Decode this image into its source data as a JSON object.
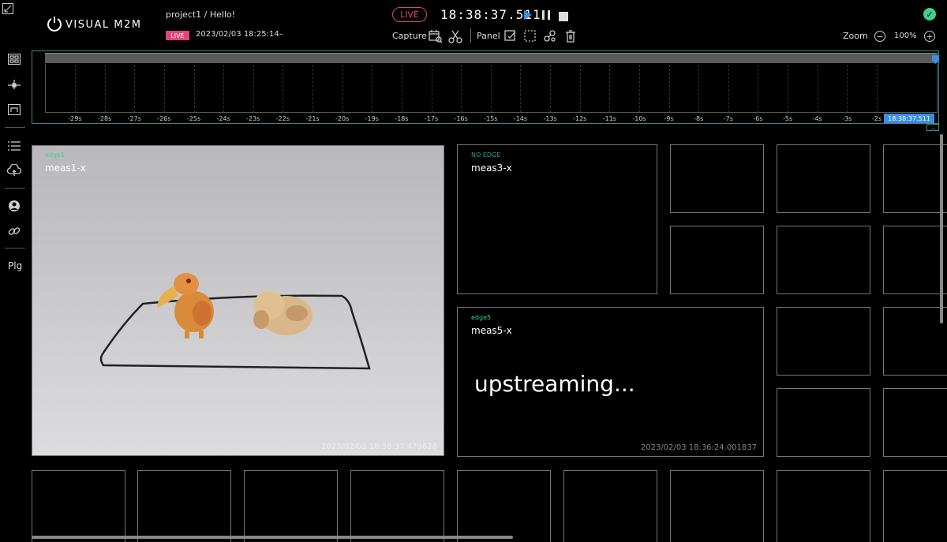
{
  "header": {
    "logo_text": "VISUAL M2M",
    "project_path": "project1 / Hello!",
    "live_badge": "LIVE",
    "start_time": "2023/02/03 18:25:14–",
    "live_pill": "LIVE",
    "clock": "18:38:37.511",
    "capture_label": "Capture",
    "panel_label": "Panel",
    "zoom_label": "Zoom",
    "zoom_value": "100%"
  },
  "sidebar": {
    "plg_label": "Plg"
  },
  "timeline": {
    "ticks": [
      "-29s",
      "-28s",
      "-27s",
      "-26s",
      "-25s",
      "-24s",
      "-23s",
      "-22s",
      "-21s",
      "-20s",
      "-19s",
      "-18s",
      "-17s",
      "-16s",
      "-15s",
      "-14s",
      "-13s",
      "-12s",
      "-11s",
      "-10s",
      "-9s",
      "-8s",
      "-7s",
      "-6s",
      "-5s",
      "-4s",
      "-3s",
      "-2s"
    ],
    "now_label": "18:38:37.511"
  },
  "panels": {
    "p1": {
      "edge": "edge1",
      "meas": "meas1-x",
      "timestamp": "2023/02/03 18:38:37.479628"
    },
    "p3": {
      "edge": "NO EDGE",
      "meas": "meas3-x"
    },
    "p5": {
      "edge": "edge5",
      "meas": "meas5-x",
      "status": "upstreaming...",
      "timestamp": "2023/02/03 18:36:24.001837"
    }
  },
  "colors": {
    "accent_live": "#e0447a",
    "accent_blue": "#3a8ee6",
    "edge_green": "#3fcf8e",
    "timeline_border": "#3a8a8a"
  }
}
